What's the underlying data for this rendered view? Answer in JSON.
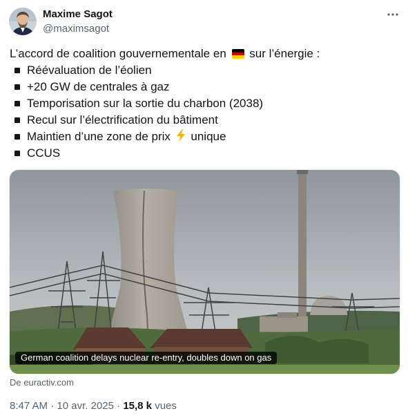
{
  "author": {
    "name": "Maxime Sagot",
    "handle": "@maximsagot"
  },
  "tweet": {
    "intro_before_flag": "L’accord de coalition gouvernementale en",
    "intro_flag_icon": "germany-flag",
    "intro_after_flag": "sur l’énergie :",
    "bullets": [
      {
        "text": "Réévaluation de l’éolien"
      },
      {
        "text": "+20 GW de centrales à gaz"
      },
      {
        "text": "Temporisation sur la sortie du charbon (2038)"
      },
      {
        "text": "Recul sur l’électrification du bâtiment"
      },
      {
        "text_before_icon": "Maintien d’une zone de prix",
        "icon": "lightning-bolt",
        "text_after_icon": "unique"
      },
      {
        "text": "CCUS"
      }
    ]
  },
  "card": {
    "caption": "German coalition delays nuclear re-entry, doubles down on gas",
    "source": "De euractiv.com"
  },
  "meta": {
    "time": "8:47 AM",
    "separator": "·",
    "date": "10 avr. 2025",
    "views_count": "15,8 k",
    "views_label": "vues"
  },
  "colors": {
    "text_primary": "#0f1419",
    "text_secondary": "#536471",
    "bolt": "#f7b500",
    "flag_black": "#000000",
    "flag_red": "#dd0000",
    "flag_gold": "#ffce00"
  }
}
